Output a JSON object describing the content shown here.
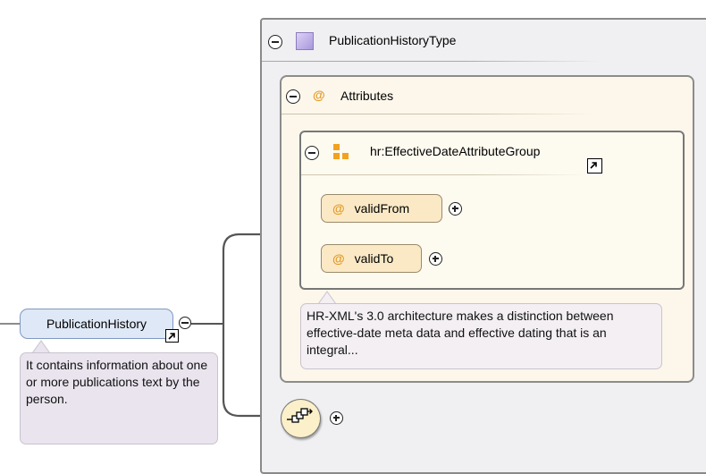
{
  "type_box": {
    "label": "PublicationHistoryType"
  },
  "attributes_box": {
    "label": "Attributes"
  },
  "attribute_group": {
    "label": "hr:EffectiveDateAttributeGroup"
  },
  "attributes": [
    {
      "label": "validFrom"
    },
    {
      "label": "validTo"
    }
  ],
  "group_doc": {
    "text": "HR-XML's 3.0 architecture makes a distinction between effective-date meta data and effective dating that is an integral..."
  },
  "element": {
    "label": "PublicationHistory",
    "doc": "It contains information about one or more publications text by the person."
  },
  "icons": {
    "attribute": "at-sign-icon",
    "group": "attribute-group-icon",
    "type": "complex-type-icon",
    "sequence": "sequence-compositor-icon"
  },
  "colors": {
    "connector": "#555555",
    "attribute_fill": "#fbe9c6",
    "attribute_symbol": "#e29a25",
    "element_fill": "#dfe8f6",
    "type_icon": "#b9a7e4"
  }
}
